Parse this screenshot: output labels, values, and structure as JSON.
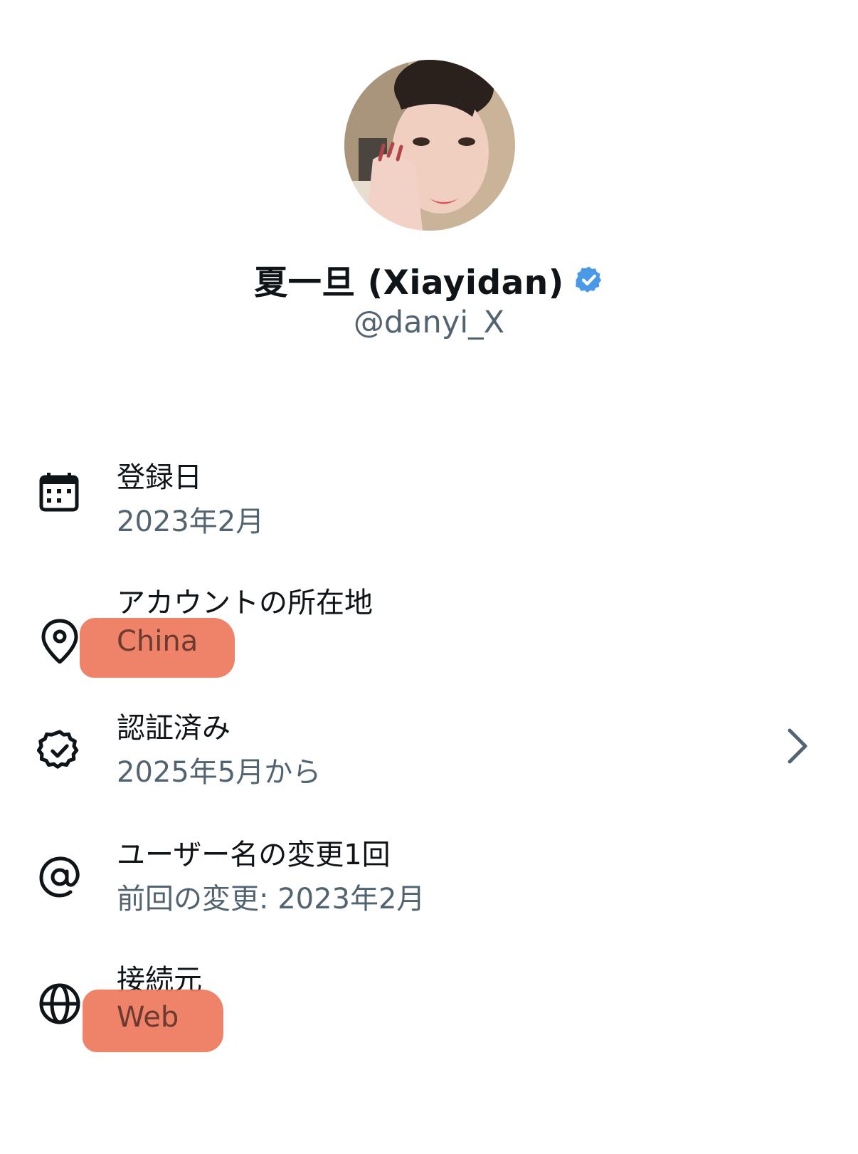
{
  "profile": {
    "display_name": "夏一旦 (Xiayidan)",
    "handle": "@danyi_X",
    "verified_badge_icon": "verified-badge-icon",
    "verified_color": "#4a99e9"
  },
  "about": {
    "joined": {
      "icon": "calendar-icon",
      "label": "登録日",
      "value": "2023年2月"
    },
    "location": {
      "icon": "location-pin-icon",
      "label": "アカウントの所在地",
      "value": "China"
    },
    "verified": {
      "icon": "verified-check-icon",
      "label": "認証済み",
      "value": "2025年5月から"
    },
    "username_changes": {
      "icon": "at-sign-icon",
      "label": "ユーザー名の変更1回",
      "value": "前回の変更: 2023年2月"
    },
    "connected_via": {
      "icon": "globe-icon",
      "label": "接続元",
      "value": "Web"
    }
  },
  "highlight_color": "#ee7c62"
}
